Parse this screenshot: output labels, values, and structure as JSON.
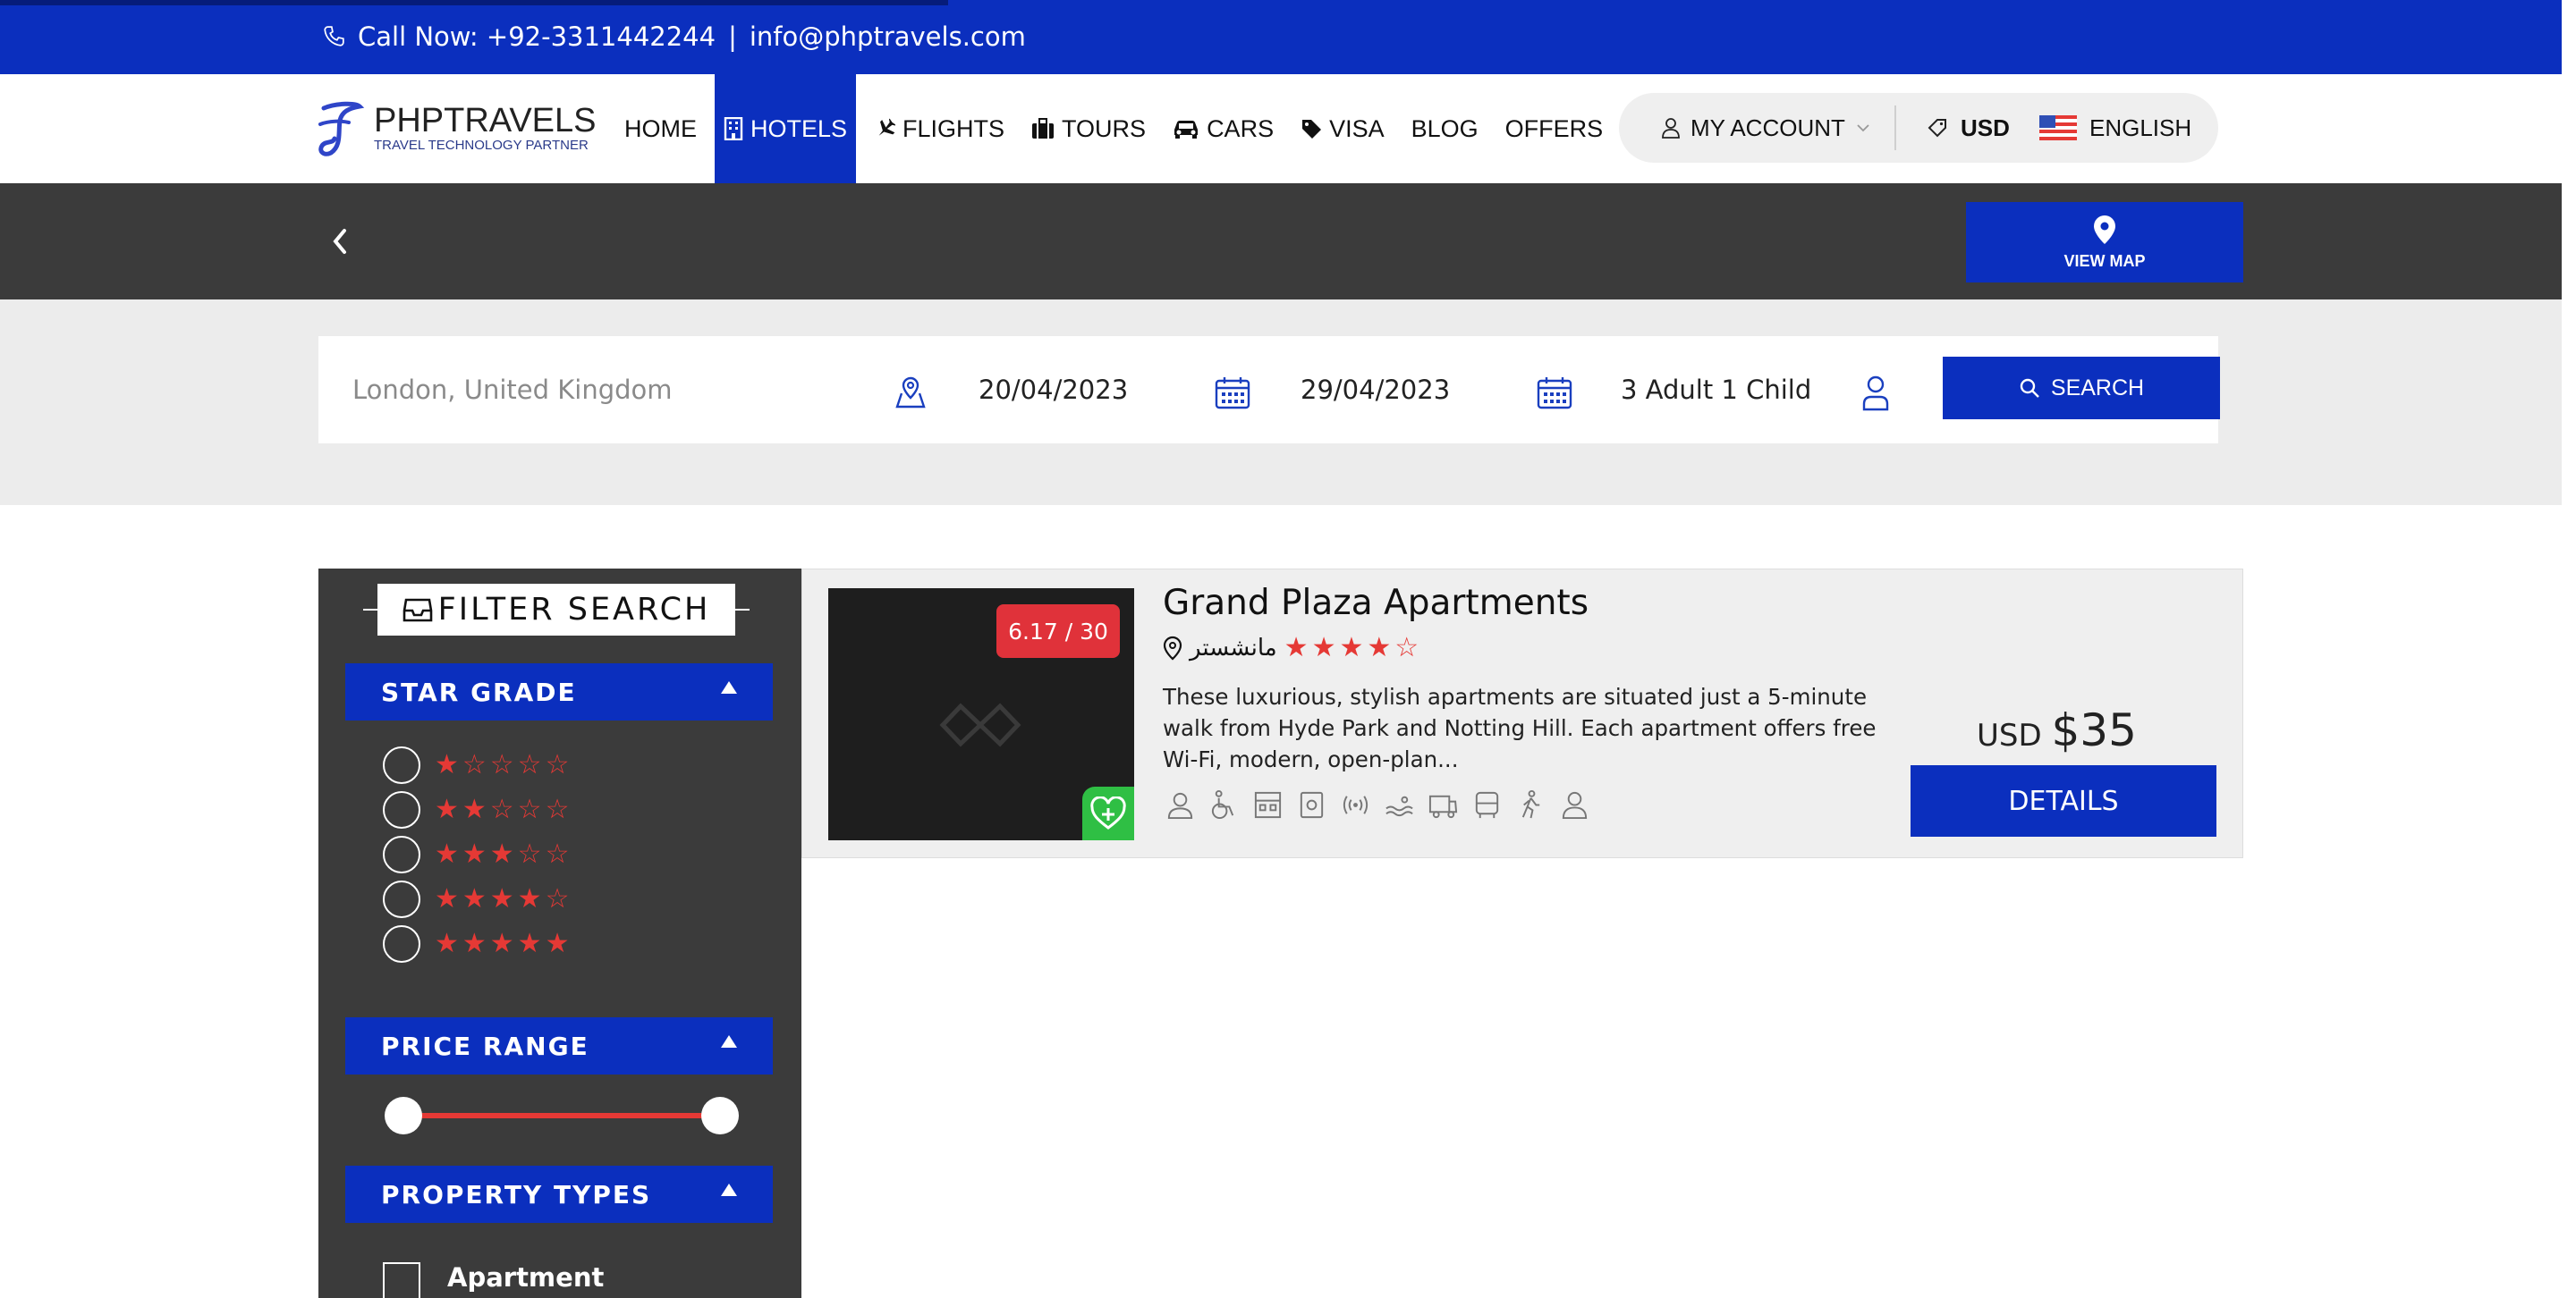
{
  "topbar": {
    "call_text": "Call Now: +92-3311442244",
    "separator": "|",
    "email": "info@phptravels.com",
    "bg_color": "#0b2fbe"
  },
  "brand": {
    "name": "PHPTRAVELS",
    "tagline": "TRAVEL TECHNOLOGY PARTNER"
  },
  "nav": {
    "items": [
      {
        "label": "HOME",
        "icon": ""
      },
      {
        "label": "HOTELS",
        "icon": "building-icon",
        "active": true
      },
      {
        "label": "FLIGHTS",
        "icon": "plane-icon"
      },
      {
        "label": "TOURS",
        "icon": "suitcase-icon"
      },
      {
        "label": "CARS",
        "icon": "car-icon"
      },
      {
        "label": "VISA",
        "icon": "tag-icon"
      },
      {
        "label": "BLOG",
        "icon": ""
      },
      {
        "label": "OFFERS",
        "icon": ""
      }
    ],
    "account_label": "MY ACCOUNT",
    "currency_label": "USD",
    "language_label": "ENGLISH"
  },
  "band": {
    "view_map_label": "VIEW MAP"
  },
  "search": {
    "location_placeholder": "London, United Kingdom",
    "checkin": "20/04/2023",
    "checkout": "29/04/2023",
    "guests": "3 Adult 1 Child",
    "button_label": "SEARCH"
  },
  "filters": {
    "title": "FILTER SEARCH",
    "star_grade_label": "STAR GRADE",
    "star_options": [
      1,
      2,
      3,
      4,
      5
    ],
    "price_range_label": "PRICE RANGE",
    "price_range": {
      "min_fraction": 0.0,
      "max_fraction": 1.0
    },
    "property_types_label": "PROPERTY TYPES",
    "property_types": [
      "Apartment"
    ]
  },
  "results": [
    {
      "name": "Grand Plaza Apartments",
      "location": "مانشستر",
      "stars": 4,
      "score": "6.17 / 30",
      "description": "These luxurious, stylish apartments are situated just a 5-minute walk from Hyde Park and Notting Hill. Each apartment offers free Wi-Fi, modern, open-plan...",
      "currency": "USD",
      "price": "$35",
      "details_label": "DETAILS",
      "amenities": [
        "concierge-icon",
        "wheelchair-icon",
        "store-icon",
        "safe-icon",
        "wifi-icon",
        "pool-icon",
        "shuttle-icon",
        "bus-icon",
        "walk-icon",
        "user-icon"
      ]
    }
  ]
}
